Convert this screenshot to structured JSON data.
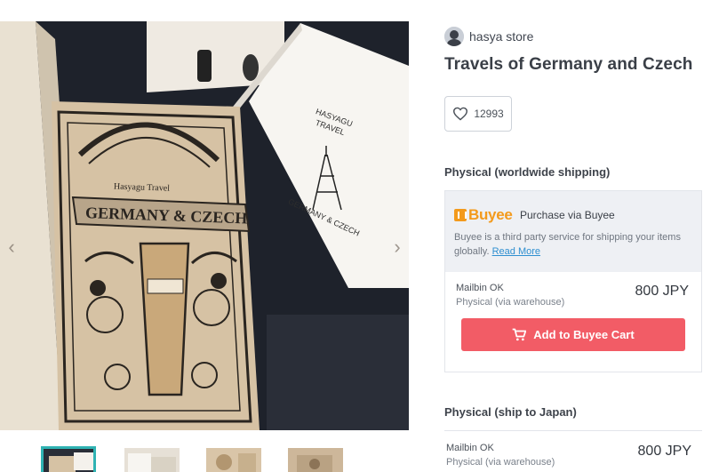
{
  "gallery": {
    "nav_prev": "‹",
    "nav_next": "›",
    "book_cover_text": "GERMANY & CZECH",
    "book_cover_subtitle": "Hasyagu Travel",
    "card_text_1": "HASYAGU",
    "card_text_2": "TRAVEL",
    "card_text_3": "GERMANY & CZECH",
    "thumbnail_count": 4,
    "active_thumbnail": 0
  },
  "shop": {
    "name": "hasya store"
  },
  "product": {
    "title": "Travels of Germany and Czech"
  },
  "likes": {
    "count": "12993"
  },
  "shipping": {
    "section1_title": "Physical (worldwide shipping)",
    "buyee": {
      "logo_text": "Buyee",
      "purchase_label": "Purchase via Buyee",
      "description": "Buyee is a third party service for shipping your items globally.",
      "read_more": "Read More"
    },
    "option1": {
      "name": "Mailbin OK",
      "subtext": "Physical (via warehouse)",
      "price": "800 JPY"
    },
    "cart_button": "Add to Buyee Cart",
    "section2_title": "Physical (ship to Japan)",
    "option2": {
      "name": "Mailbin OK",
      "subtext": "Physical (via warehouse)",
      "price": "800 JPY"
    }
  },
  "colors": {
    "accent": "#f25c66",
    "buyee_orange": "#f39a1c",
    "thumb_active": "#2fb3b3",
    "link": "#2e8fd0"
  }
}
